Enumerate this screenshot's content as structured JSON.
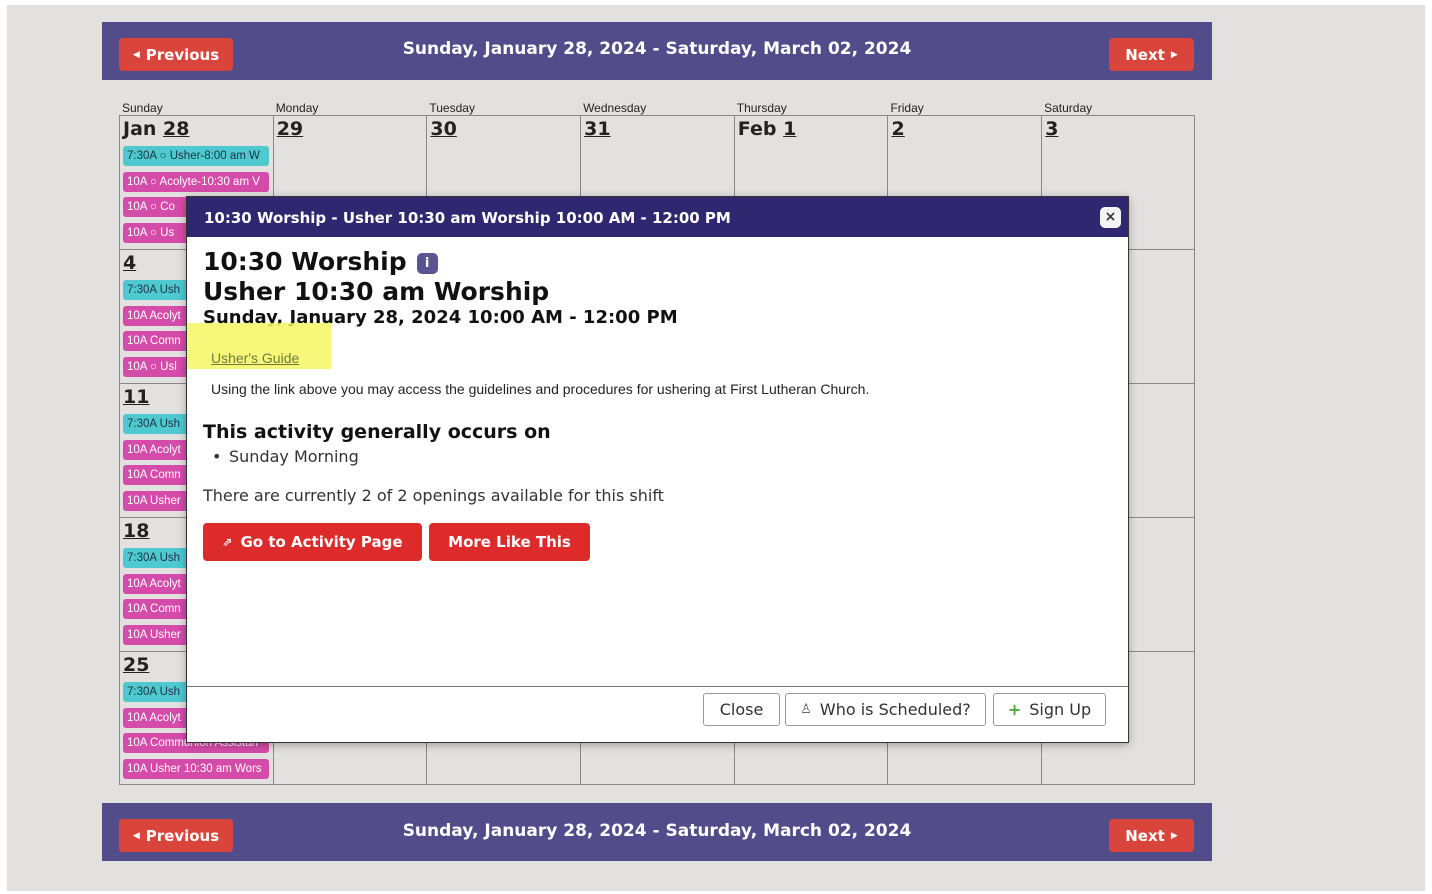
{
  "nav": {
    "prev_label": "Previous",
    "next_label": "Next",
    "range_title": "Sunday, January 28, 2024 - Saturday, March 02, 2024"
  },
  "days_of_week": [
    "Sunday",
    "Monday",
    "Tuesday",
    "Wednesday",
    "Thursday",
    "Friday",
    "Saturday"
  ],
  "week1_dates": [
    {
      "prefix": "Jan ",
      "num": "28"
    },
    {
      "prefix": "",
      "num": "29"
    },
    {
      "prefix": "",
      "num": "30"
    },
    {
      "prefix": "",
      "num": "31"
    },
    {
      "prefix": "Feb ",
      "num": "1"
    },
    {
      "prefix": "",
      "num": "2"
    },
    {
      "prefix": "",
      "num": "3"
    }
  ],
  "sunday_dates": [
    "4",
    "11",
    "18",
    "25"
  ],
  "week1_events": [
    {
      "text": "7:30A ○ Usher-8:00 am W",
      "color": "cyan"
    },
    {
      "text": "10A ○ Acolyte-10:30 am V",
      "color": "pink"
    },
    {
      "text": "10A ○ Co",
      "color": "pink"
    },
    {
      "text": "10A ○ Us",
      "color": "pink"
    }
  ],
  "week_events": [
    [
      {
        "text": "7:30A Ush",
        "color": "cyan"
      },
      {
        "text": "10A Acolyt",
        "color": "pink"
      },
      {
        "text": "10A Comn",
        "color": "pink"
      },
      {
        "text": "10A ○ Usl",
        "color": "pink"
      }
    ],
    [
      {
        "text": "7:30A Ush",
        "color": "cyan"
      },
      {
        "text": "10A Acolyt",
        "color": "pink"
      },
      {
        "text": "10A Comn",
        "color": "pink"
      },
      {
        "text": "10A Usher",
        "color": "pink"
      }
    ],
    [
      {
        "text": "7:30A Ush",
        "color": "cyan"
      },
      {
        "text": "10A Acolyt",
        "color": "pink"
      },
      {
        "text": "10A Comn",
        "color": "pink"
      },
      {
        "text": "10A Usher",
        "color": "pink"
      }
    ],
    [
      {
        "text": "7:30A Ush",
        "color": "cyan"
      },
      {
        "text": "10A Acolyt",
        "color": "pink"
      },
      {
        "text": "10A Communion Assistan",
        "color": "pink"
      },
      {
        "text": "10A Usher 10:30 am Wors",
        "color": "pink"
      }
    ]
  ],
  "modal": {
    "header": "10:30 Worship - Usher 10:30 am Worship 10:00 AM - 12:00 PM",
    "close_x": "×",
    "title_line1": "10:30 Worship",
    "title_line2": "Usher 10:30 am Worship",
    "datetime": "Sunday, January 28, 2024 10:00 AM - 12:00 PM",
    "guide_link": "Usher's Guide",
    "description": "Using the link above you may access the guidelines and procedures for ushering at First Lutheran Church.",
    "occurs_heading": "This activity generally occurs on",
    "occurs_item": "Sunday Morning",
    "openings": "There are currently 2 of 2 openings available for this shift",
    "activity_button": "Go to Activity Page",
    "more_button": "More Like This",
    "close_button": "Close",
    "who_button": "Who is Scheduled?",
    "signup_button": "Sign Up"
  },
  "colors": {
    "nav_bg": "#524c8a",
    "nav_button": "#d9453b",
    "modal_header": "#2f2870",
    "event_cyan": "#4dc9cf",
    "event_pink": "#d54ba9",
    "action_red": "#dd2b2b"
  }
}
